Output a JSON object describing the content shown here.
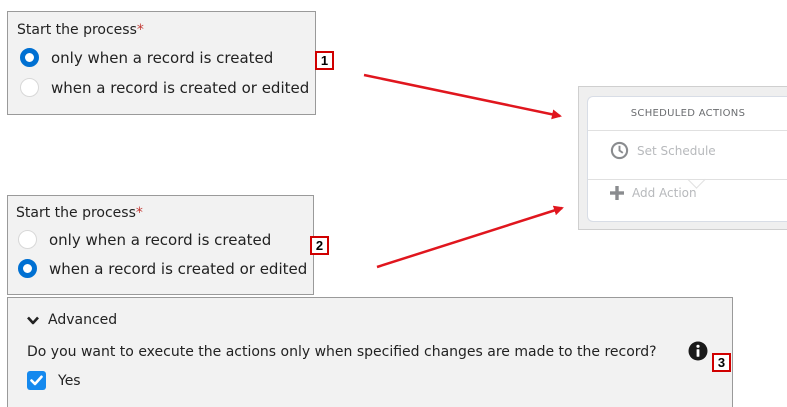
{
  "panel1": {
    "title": "Start the process",
    "required_mark": "*",
    "options": [
      "only when a record is created",
      "when a record is created or edited"
    ],
    "selected_index": 0
  },
  "panel2": {
    "title": "Start the process",
    "required_mark": "*",
    "options": [
      "only when a record is created",
      "when a record is created or edited"
    ],
    "selected_index": 1
  },
  "callouts": [
    "1",
    "2",
    "3"
  ],
  "scheduled_actions": {
    "header": "SCHEDULED ACTIONS",
    "set_schedule": "Set Schedule",
    "add_action": "Add Action"
  },
  "advanced": {
    "label": "Advanced",
    "question": "Do you want to execute the actions only when specified changes are made to the record?",
    "checkbox_label": "Yes",
    "checked": true
  },
  "colors": {
    "accent": "#0070d2",
    "checkbox": "#1589ee",
    "arrow": "#e0161e",
    "required": "#c23934"
  },
  "icons": [
    "clock-icon",
    "plus-icon",
    "chevron-down-icon",
    "info-icon",
    "check-icon"
  ]
}
